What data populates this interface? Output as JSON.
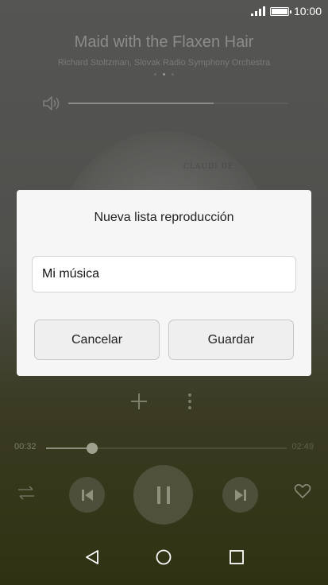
{
  "status_bar": {
    "time": "10:00",
    "signal_icon": "signal-icon",
    "battery_icon": "battery-icon"
  },
  "player": {
    "title": "Maid with the Flaxen Hair",
    "artist": "Richard Stoltzman, Slovak Radio Symphony Orchestra",
    "volume_fraction": 0.66,
    "album_text": "CLAUDI DE",
    "current_time": "00:32",
    "total_time": "02:49",
    "progress_fraction": 0.19,
    "icons": {
      "volume": "speaker-icon",
      "add": "plus-icon",
      "more": "more-vertical-icon",
      "shuffle": "repeat-icon",
      "previous": "skip-previous-icon",
      "pause": "pause-icon",
      "next": "skip-next-icon",
      "favorite": "heart-icon"
    }
  },
  "dialog": {
    "title": "Nueva lista reproducción",
    "input_value": "Mi música",
    "cancel_label": "Cancelar",
    "save_label": "Guardar"
  },
  "navbar": {
    "back_icon": "back-icon",
    "home_icon": "home-icon",
    "recents_icon": "recents-icon"
  },
  "colors": {
    "dialog_bg": "#f6f6f6",
    "overlay_text": "#8c8c8a",
    "accent": "#9fa08e"
  }
}
